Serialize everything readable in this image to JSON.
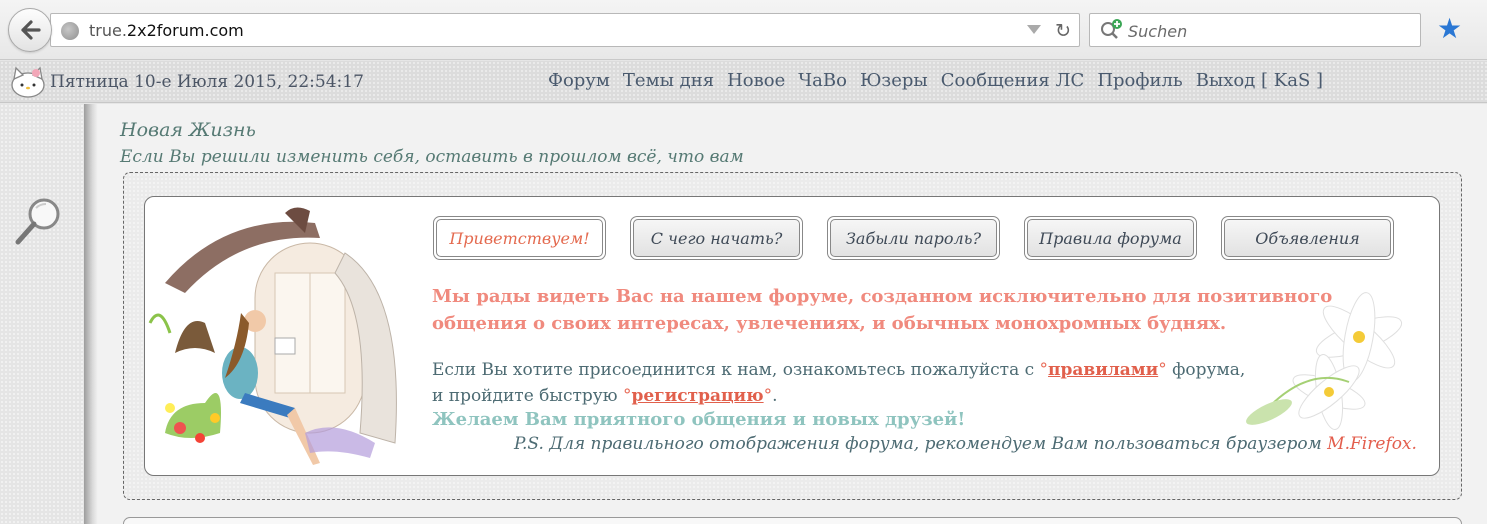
{
  "browser": {
    "url_prefix": "true.",
    "url_domain": "2x2forum.com",
    "search_placeholder": "Suchen"
  },
  "header": {
    "datetime": "Пятница 10-е Июля 2015, 22:54:17",
    "nav": [
      "Форум",
      "Темы дня",
      "Новое",
      "ЧаВо",
      "Юзеры",
      "Сообщения ЛС",
      "Профиль",
      "Выход [ KaS ]"
    ]
  },
  "forum": {
    "title": "Новая Жизнь",
    "description": "Если Вы решили изменить себя, оставить в прошлом всё, что вам"
  },
  "welcome": {
    "buttons": [
      "Приветствуем!",
      "С чего начать?",
      "Забыли пароль?",
      "Правила форума",
      "Объявления"
    ],
    "headline": "Мы рады видеть Вас на нашем форуме, созданном исключительно для позитивного общения о своих интересах, увлечениях, и обычных монохромных буднях.",
    "join_line1_pre": "Если Вы хотите присоединится к нам, ознакомьтесь пожалуйста с ",
    "deg_open": "°",
    "rules_link": "правилами",
    "deg_close": "°",
    "join_line1_post": " форума,",
    "join_line2_pre": "и пройдите быструю ",
    "register_link": "регистрацию",
    "join_line2_post": ".",
    "wish": "Желаем Вам приятного общения и новых друзей!",
    "ps_text": "P.S. Для правильного отображения форума, рекомендуем Вам пользоваться браузером ",
    "ps_browser": "M.Firefox."
  },
  "colors": {
    "accent_red": "#f08a7e",
    "link_red": "#e1604c",
    "teal_text": "#4d6b73",
    "wish_teal": "#8fc4bf",
    "nav_text": "#4a5a6e"
  },
  "icons": [
    "back-arrow-icon",
    "globe-icon",
    "dropdown-arrow-icon",
    "reload-icon",
    "search-add-icon",
    "bookmark-star-icon",
    "kitty-icon",
    "magnifier-icon"
  ]
}
